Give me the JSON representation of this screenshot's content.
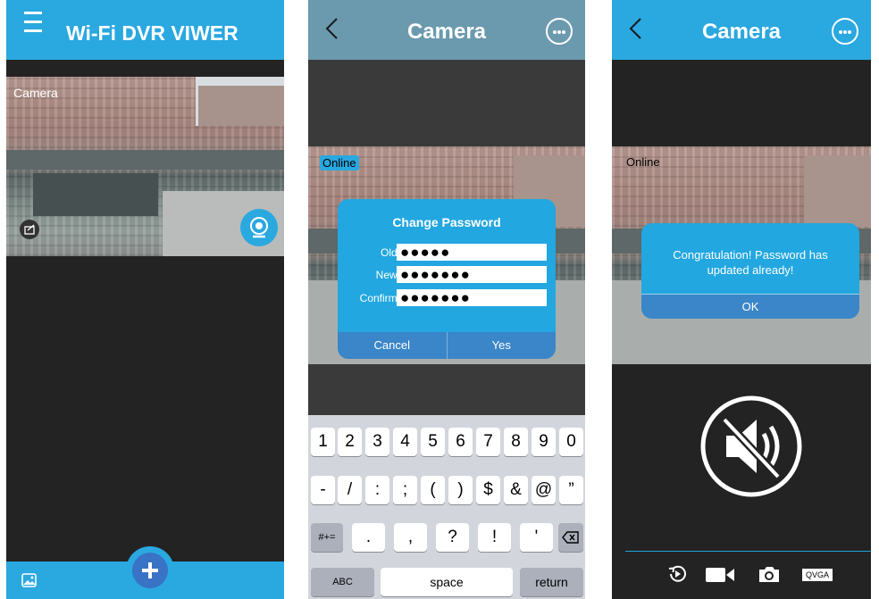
{
  "screen1": {
    "app_title": "Wi-Fi DVR VIWER",
    "camera_label": "Camera",
    "icons": [
      "menu-icon",
      "export-icon",
      "webcam-icon",
      "gallery-icon",
      "add-icon"
    ]
  },
  "screen2": {
    "nav_title": "Camera",
    "status": "Online",
    "dialog": {
      "title": "Change Password",
      "old_label": "Old:",
      "old_value": "●●●●●",
      "new_label": "New:",
      "new_value": "●●●●●●●",
      "confirm_label": "Confirm:",
      "confirm_value": "●●●●●●●",
      "cancel": "Cancel",
      "yes": "Yes"
    },
    "keyboard": {
      "row1": [
        "1",
        "2",
        "3",
        "4",
        "5",
        "6",
        "7",
        "8",
        "9",
        "0"
      ],
      "row2": [
        "-",
        "/",
        ":",
        ";",
        "(",
        ")",
        "$",
        "&",
        "@",
        "”"
      ],
      "row3_left": "#+=",
      "row3": [
        ".",
        ",",
        "?",
        "!",
        "'"
      ],
      "abc": "ABC",
      "space": "space",
      "return": "return"
    }
  },
  "screen3": {
    "nav_title": "Camera",
    "status": "Online",
    "alert": {
      "message": "Congratulation! Password has updated already!",
      "ok": "OK"
    },
    "quality": "QVGA",
    "icons": [
      "mute-speaker-icon",
      "playback-icon",
      "record-video-icon",
      "snapshot-camera-icon"
    ]
  },
  "colors": {
    "accent_blue": "#2aa8e0",
    "header_gray_blue": "#6b9aae",
    "fab_inner": "#3873c5",
    "button_bar_blue": "#3a86c8",
    "keyboard_bg": "#d2d5db"
  }
}
